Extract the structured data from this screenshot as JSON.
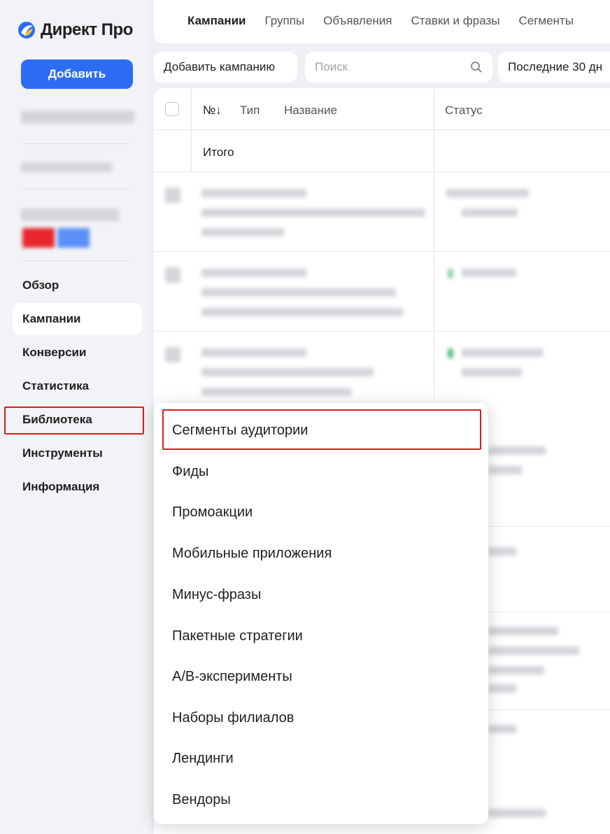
{
  "brand": {
    "name": "Директ Про"
  },
  "sidebar": {
    "add_button": "Добавить",
    "items": [
      {
        "label": "Обзор"
      },
      {
        "label": "Кампании"
      },
      {
        "label": "Конверсии"
      },
      {
        "label": "Статистика"
      },
      {
        "label": "Библиотека"
      },
      {
        "label": "Инструменты"
      },
      {
        "label": "Информация"
      }
    ]
  },
  "header": {
    "tabs": [
      {
        "label": "Кампании"
      },
      {
        "label": "Группы"
      },
      {
        "label": "Объявления"
      },
      {
        "label": "Ставки и фразы"
      },
      {
        "label": "Сегменты"
      }
    ]
  },
  "toolbar": {
    "add_campaign": "Добавить кампанию",
    "search_placeholder": "Поиск",
    "period": "Последние 30 дн"
  },
  "table": {
    "columns": {
      "num": "№↓",
      "type": "Тип",
      "name": "Название",
      "status": "Статус"
    },
    "total_label": "Итого"
  },
  "library_menu": {
    "items": [
      {
        "label": "Сегменты аудитории"
      },
      {
        "label": "Фиды"
      },
      {
        "label": "Промоакции"
      },
      {
        "label": "Мобильные приложения"
      },
      {
        "label": "Минус-фразы"
      },
      {
        "label": "Пакетные стратегии"
      },
      {
        "label": "А/В-эксперименты"
      },
      {
        "label": "Наборы филиалов"
      },
      {
        "label": "Лендинги"
      },
      {
        "label": "Вендоры"
      }
    ]
  },
  "colors": {
    "accent": "#2d6df6",
    "highlight": "#e0191b"
  }
}
